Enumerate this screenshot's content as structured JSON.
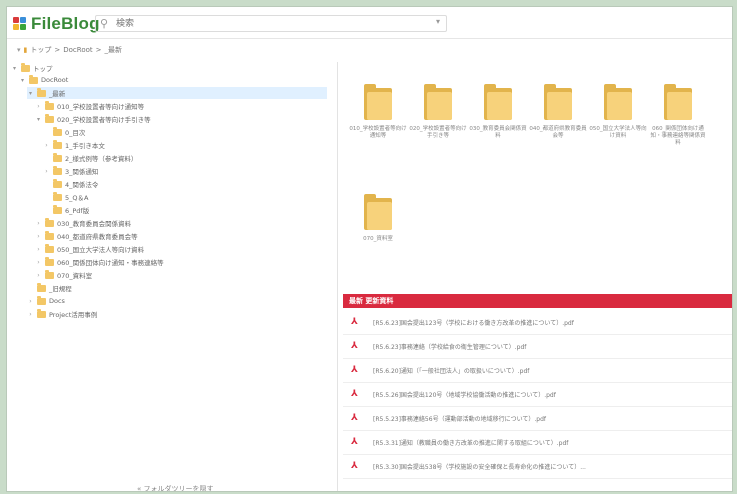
{
  "header": {
    "app_name": "FileBlog",
    "search_placeholder": "検索",
    "logo_colors": [
      "#d93b3b",
      "#3a8fd9",
      "#f2b530",
      "#3aa53a"
    ]
  },
  "breadcrumb": {
    "root": "トップ",
    "sep1": ">",
    "item1": "DocRoot",
    "sep2": ">",
    "item2": "_最新"
  },
  "sidebar": {
    "tree": [
      {
        "label": "トップ",
        "toggle": "▾"
      },
      {
        "label": "DocRoot",
        "toggle": "▾"
      },
      {
        "label": "_最新",
        "toggle": "▾",
        "selected": true
      },
      {
        "label": "010_学校設置者等向け通知等",
        "toggle": "›"
      },
      {
        "label": "020_学校設置者等向け手引き等",
        "toggle": "▾"
      },
      {
        "label": "0_目次",
        "toggle": ""
      },
      {
        "label": "1_手引き本文",
        "toggle": "›"
      },
      {
        "label": "2_様式例等（参考資料）",
        "toggle": ""
      },
      {
        "label": "3_関係通知",
        "toggle": "›"
      },
      {
        "label": "4_関係法令",
        "toggle": ""
      },
      {
        "label": "5_Q＆A",
        "toggle": ""
      },
      {
        "label": "6_Pdf版",
        "toggle": ""
      },
      {
        "label": "030_教育委員会関係資料",
        "toggle": "›"
      },
      {
        "label": "040_都道府県教育委員会等",
        "toggle": "›"
      },
      {
        "label": "050_国立大学法人等向け資料",
        "toggle": "›"
      },
      {
        "label": "060_関係団体向け通知・事務連絡等",
        "toggle": "›"
      },
      {
        "label": "070_資料室",
        "toggle": "›"
      },
      {
        "label": "_旧規程",
        "toggle": ""
      },
      {
        "label": "Docs",
        "toggle": "›"
      },
      {
        "label": "Project活用事例",
        "toggle": "›"
      }
    ],
    "collapse_label": "« フォルダツリーを隠す"
  },
  "main": {
    "tiles": [
      {
        "label": "010_学校設置者等向け通知等"
      },
      {
        "label": "020_学校設置者等向け手引き等"
      },
      {
        "label": "030_教育委員会関係資料"
      },
      {
        "label": "040_都道府県教育委員会等"
      },
      {
        "label": "050_国立大学法人等向け資料"
      },
      {
        "label": "060_関係団体向け通知・事務連絡等関係資料"
      },
      {
        "label": "070_資料室"
      }
    ],
    "updates_title": "最新 更新資料",
    "updates": [
      {
        "text": "[R5.6.23]国会提出123号（学校における働き方改革の推進について）.pdf"
      },
      {
        "text": "[R5.6.23]事務連絡（学校給食の衛生管理について）.pdf"
      },
      {
        "text": "[R5.6.20]通知（「一般社団法人」の取扱いについて）.pdf"
      },
      {
        "text": "[R5.5.26]国会提出120号（地域学校協働活動の推進について）.pdf"
      },
      {
        "text": "[R5.5.23]事務連絡56号（運動部活動の地域移行について）.pdf"
      },
      {
        "text": "[R5.3.31]通知（教職員の働き方改革の推進に関する取組について）.pdf"
      },
      {
        "text": "[R5.3.30]国会提出538号（学校施設の安全確保と長寿命化の推進について）..."
      }
    ]
  }
}
